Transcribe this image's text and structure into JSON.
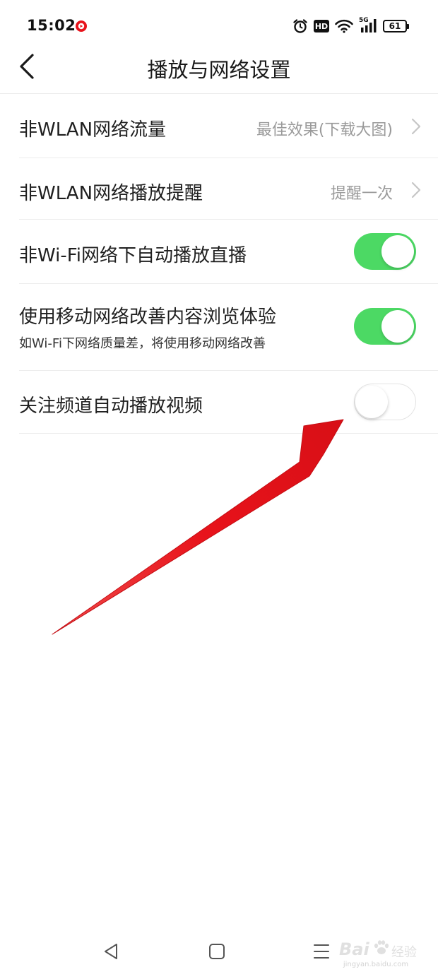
{
  "status_bar": {
    "time": "15:02",
    "hd_label": "HD",
    "network_label": "5G",
    "battery_level": "61"
  },
  "header": {
    "title": "播放与网络设置"
  },
  "settings": [
    {
      "label": "非WLAN网络流量",
      "value": "最佳效果(下载大图)",
      "type": "link"
    },
    {
      "label": "非WLAN网络播放提醒",
      "value": "提醒一次",
      "type": "link"
    },
    {
      "label": "非Wi-Fi网络下自动播放直播",
      "type": "toggle",
      "on": true
    },
    {
      "label": "使用移动网络改善内容浏览体验",
      "sublabel": "如Wi-Fi下网络质量差，将使用移动网络改善",
      "type": "toggle",
      "on": true
    },
    {
      "label": "关注频道自动播放视频",
      "type": "toggle",
      "on": false
    }
  ],
  "colors": {
    "toggle_on": "#4cd964",
    "arrow": "#e8131b",
    "value_text": "#9a9a9a",
    "divider": "#ececec"
  },
  "icons": {
    "back": "chevron-left-icon",
    "row_arrow": "chevron-right-icon",
    "nav_back": "triangle-back-icon",
    "nav_home": "square-home-icon",
    "nav_recents": "menu-lines-icon"
  },
  "watermark": {
    "brand": "Bai",
    "brand_suffix": "经验",
    "url": "jingyan.baidu.com"
  }
}
